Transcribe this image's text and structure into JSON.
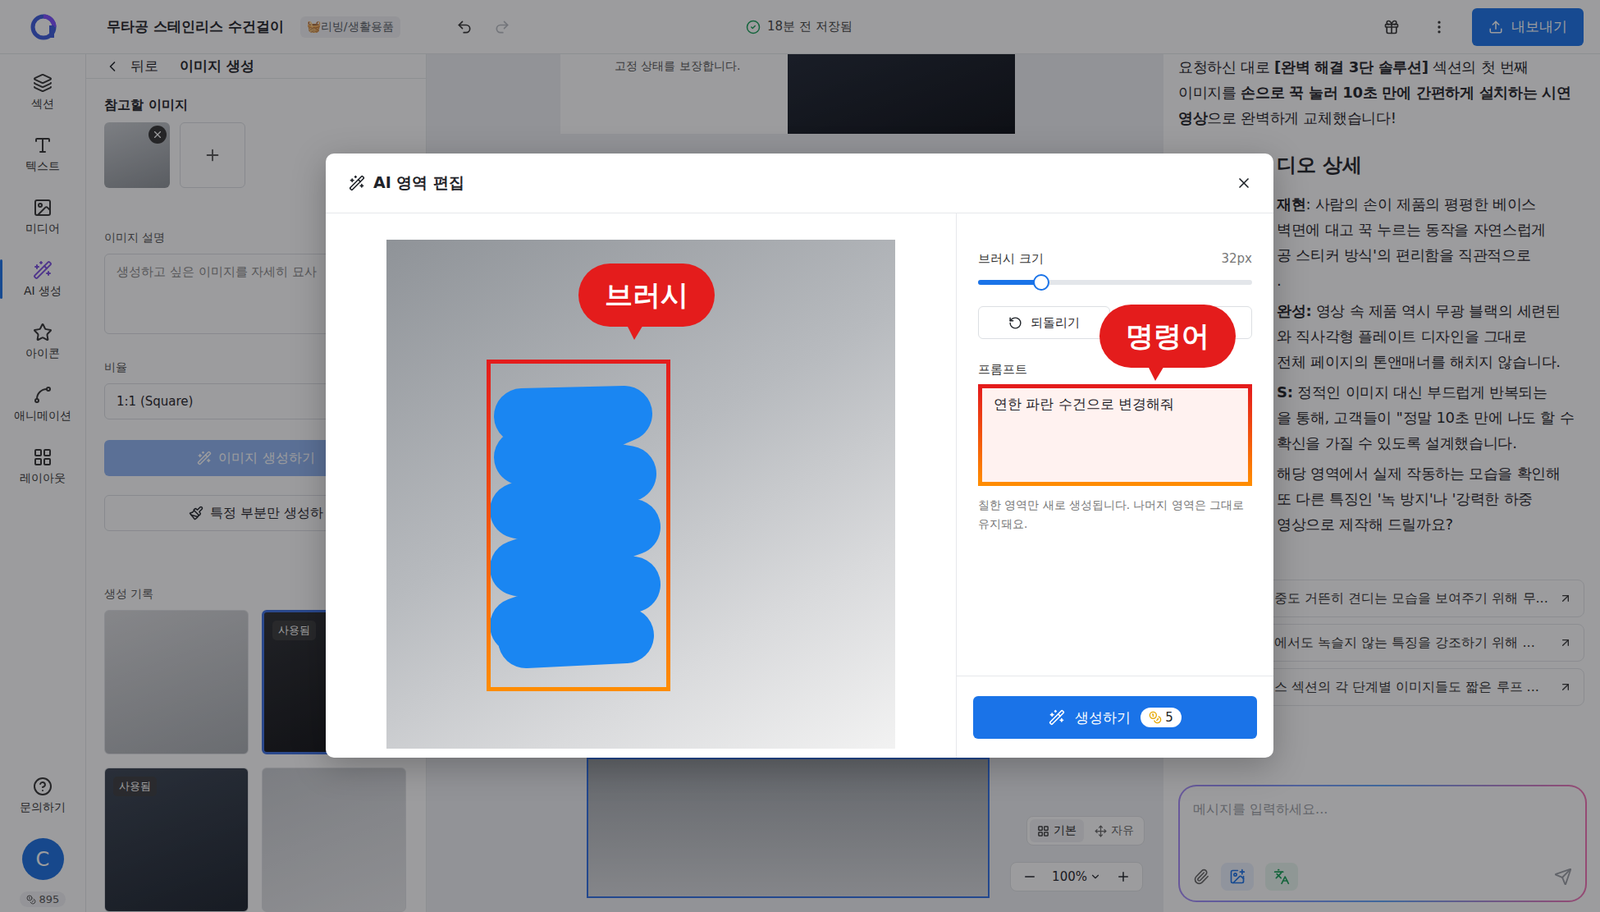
{
  "topbar": {
    "title": "무타공 스테인리스 수건걸이",
    "category": "🧺리빙/생활용품",
    "saved": "18분 전 저장됨",
    "export": "내보내기"
  },
  "rail": {
    "items": [
      {
        "label": "섹션",
        "selected": false
      },
      {
        "label": "텍스트",
        "selected": false
      },
      {
        "label": "미디어",
        "selected": false
      },
      {
        "label": "AI 생성",
        "selected": true
      },
      {
        "label": "아이콘",
        "selected": false
      },
      {
        "label": "애니메이션",
        "selected": false
      },
      {
        "label": "레이아웃",
        "selected": false
      }
    ],
    "help": "문의하기",
    "avatar": "C",
    "credits": "895"
  },
  "panel": {
    "back": "뒤로",
    "title": "이미지 생성",
    "reference_label": "참고할 이미지",
    "description_label": "이미지 설명",
    "description_placeholder": "생성하고 싶은 이미지를 자세히 묘사",
    "ratio_label": "비율",
    "ratio": "1:1 (Square)",
    "generate": "이미지 생성하기",
    "generate_disabled": true,
    "partial": "특정 부분만 생성하",
    "history_label": "생성 기록",
    "history": [
      {
        "badge": "",
        "used": false,
        "selected": false
      },
      {
        "badge": "사용됨",
        "used": true,
        "selected": true
      },
      {
        "badge": "사용됨",
        "used": true,
        "selected": false
      },
      {
        "badge": "",
        "used": false,
        "selected": false
      }
    ]
  },
  "canvas": {
    "caption": "고정 상태를 보장합니다.",
    "modes": [
      {
        "label": "기본",
        "selected": true
      },
      {
        "label": "자유",
        "selected": false
      }
    ],
    "zoom": "100%"
  },
  "chat": {
    "intro": [
      {
        "cut": false,
        "parts": [
          {
            "text": "요청하신 대로 ",
            "bold": false
          },
          {
            "text": "[완벽 해결 3단 솔루션]",
            "bold": true
          },
          {
            "text": " 섹션의 첫 번째",
            "bold": false
          }
        ]
      },
      {
        "cut": false,
        "parts": [
          {
            "text": "이미지를 ",
            "bold": false
          },
          {
            "text": "손으로 꾹 눌러 10초 만에 간편하게 설치하는 시연",
            "bold": true
          }
        ]
      },
      {
        "cut": false,
        "parts": [
          {
            "text": "영상",
            "bold": true
          },
          {
            "text": "으로 완벽하게 교체했습니다!",
            "bold": false
          }
        ]
      }
    ],
    "heading": "디오 상세",
    "groups": [
      [
        {
          "cut": true,
          "parts": [
            {
              "text": "재현",
              "bold": true
            },
            {
              "text": ": 사람의 손이 제품의 평평한 베이스",
              "bold": false
            }
          ]
        },
        {
          "cut": true,
          "parts": [
            {
              "text": "벽면에 대고 꾹 누르는 동작을 자연스럽게",
              "bold": false
            }
          ]
        },
        {
          "cut": true,
          "parts": [
            {
              "text": "공 스티커 방식'의 편리함을 직관적으로",
              "bold": false
            }
          ]
        },
        {
          "cut": true,
          "parts": [
            {
              "text": ".",
              "bold": false
            }
          ]
        }
      ],
      [
        {
          "cut": true,
          "parts": [
            {
              "text": "완성:",
              "bold": true
            },
            {
              "text": " 영상 속 제품 역시 무광 블랙의 세련된",
              "bold": false
            }
          ]
        },
        {
          "cut": true,
          "parts": [
            {
              "text": "와 직사각형 플레이트 디자인을 그대로",
              "bold": false
            }
          ]
        },
        {
          "cut": true,
          "parts": [
            {
              "text": "전체 페이지의 톤앤매너를 해치지 않습니다.",
              "bold": false
            }
          ]
        }
      ],
      [
        {
          "cut": true,
          "parts": [
            {
              "text": "S:",
              "bold": true
            },
            {
              "text": " 정적인 이미지 대신 부드럽게 반복되는",
              "bold": false
            }
          ]
        },
        {
          "cut": true,
          "parts": [
            {
              "text": "을 통해, 고객들이 \"정말 10초 만에 나도 할 수",
              "bold": false
            }
          ]
        },
        {
          "cut": true,
          "parts": [
            {
              "text": "확신을 가질 수 있도록 설계했습니다.",
              "bold": false
            }
          ]
        }
      ],
      [
        {
          "cut": true,
          "parts": [
            {
              "text": "해당 영역에서 실제 작동하는 모습을 확인해",
              "bold": false
            }
          ]
        },
        {
          "cut": true,
          "parts": [
            {
              "text": "또 다른 특징인 '녹 방지'나 '강력한 하중",
              "bold": false
            }
          ]
        },
        {
          "cut": true,
          "parts": [
            {
              "text": "영상으로 제작해 드릴까요?",
              "bold": false
            }
          ]
        }
      ]
    ],
    "suggestions": [
      "중도 거뜬히 견디는 모습을 보여주기 위해 무...",
      "에서도 녹슬지 않는 특징을 강조하기 위해 ...",
      "스 섹션의 각 단계별 이미지들도 짧은 루프 ..."
    ],
    "input_placeholder": "메시지를 입력하세요..."
  },
  "modal": {
    "title": "AI 영역 편집",
    "brush_label": "브러시 크기",
    "brush_value": "32px",
    "brush_level": 0.23,
    "undo": "되돌리기",
    "prompt_label": "프롬프트",
    "prompt": "연한 파란 수건으로 변경해줘",
    "helper": "칠한 영역만 새로 생성됩니다. 나머지 영역은 그대로 유지돼요.",
    "generate": "생성하기",
    "cost": "5"
  },
  "annotations": {
    "brush": "브러시",
    "prompt": "명령어"
  }
}
